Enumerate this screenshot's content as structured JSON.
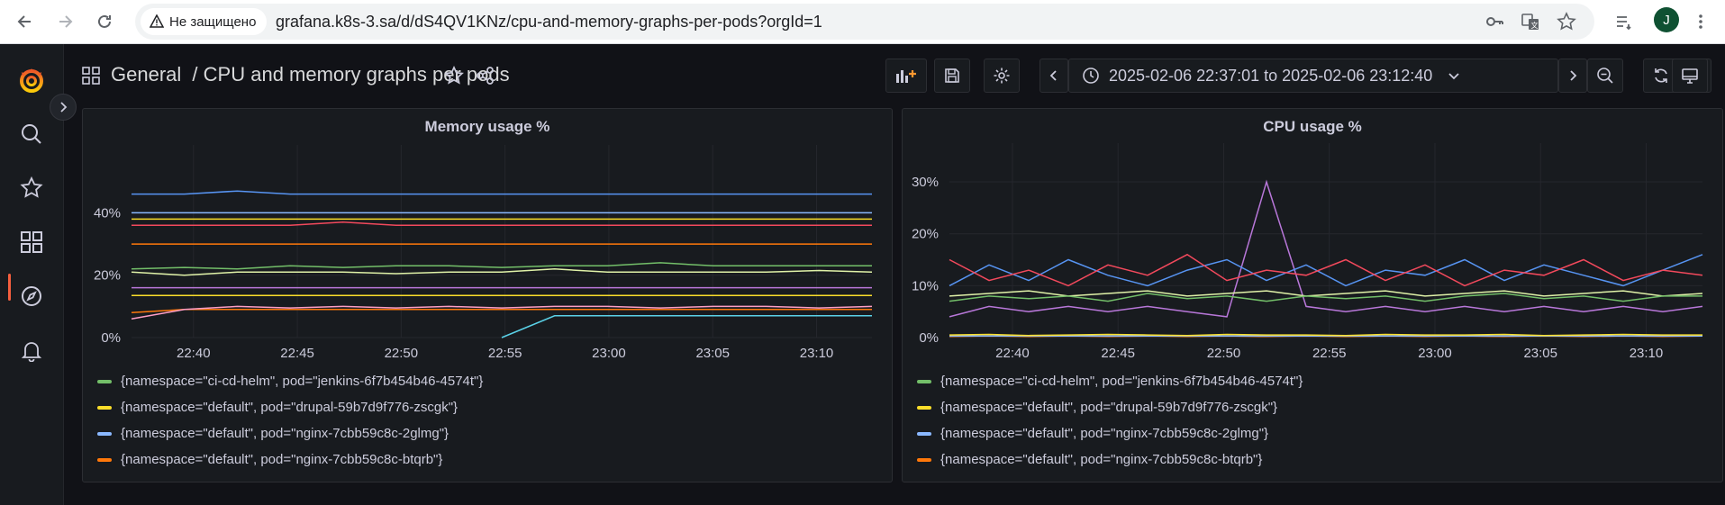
{
  "browser": {
    "security_label": "Не защищено",
    "url": "grafana.k8s-3.sa/d/dS4QV1KNz/cpu-and-memory-graphs-per-pods?orgId=1",
    "avatar_letter": "J"
  },
  "header": {
    "breadcrumb_root": "General",
    "separator": "/",
    "dashboard_title": "CPU and memory graphs per pods",
    "time_range": "2025-02-06 22:37:01 to 2025-02-06 23:12:40"
  },
  "colors": {
    "green": "#73bf69",
    "yellow": "#fade2a",
    "blue": "#8ab8ff",
    "orange": "#ff780a",
    "red": "#f2495c",
    "purple": "#b877d9",
    "darkblue": "#5794f2",
    "pink": "#ff9ec5",
    "cyan": "#5ad2e8",
    "lime": "#e0f2a8"
  },
  "legend": [
    {
      "label": "{namespace=\"ci-cd-helm\", pod=\"jenkins-6f7b454b46-4574t\"}",
      "color": "#73bf69"
    },
    {
      "label": "{namespace=\"default\", pod=\"drupal-59b7d9f776-zscgk\"}",
      "color": "#fade2a"
    },
    {
      "label": "{namespace=\"default\", pod=\"nginx-7cbb59c8c-2glmg\"}",
      "color": "#8ab8ff"
    },
    {
      "label": "{namespace=\"default\", pod=\"nginx-7cbb59c8c-btqrb\"}",
      "color": "#ff780a"
    }
  ],
  "chart_data": [
    {
      "type": "line",
      "title": "Memory usage %",
      "x_ticks": [
        "22:40",
        "22:45",
        "22:50",
        "22:55",
        "23:00",
        "23:05",
        "23:10"
      ],
      "y_ticks": [
        "0%",
        "20%",
        "40%"
      ],
      "ylim": [
        0,
        56
      ],
      "x_range": [
        "22:37:01",
        "23:12:40"
      ],
      "grid": true,
      "legend_placement": "bottom",
      "series": [
        {
          "name": "{namespace=\"ci-cd-helm\", pod=\"jenkins-6f7b454b46-4574t\"}",
          "color": "#73bf69",
          "values": [
            22,
            22.5,
            22,
            23,
            22.5,
            23,
            23,
            22.5,
            23,
            23,
            24,
            23,
            23,
            23,
            23
          ]
        },
        {
          "name": "{namespace=\"default\", pod=\"drupal-59b7d9f776-zscgk\"}",
          "color": "#fade2a",
          "values": [
            38,
            38,
            38,
            38,
            38,
            38,
            38,
            38,
            38,
            38,
            38,
            38,
            38,
            38,
            38
          ]
        },
        {
          "name": "{namespace=\"default\", pod=\"nginx-7cbb59c8c-2glmg\"}",
          "color": "#8ab8ff",
          "values": [
            40,
            40,
            40,
            40,
            40,
            40,
            40,
            40,
            40,
            40,
            40,
            40,
            40,
            40,
            40
          ]
        },
        {
          "name": "{namespace=\"default\", pod=\"nginx-7cbb59c8c-btqrb\"}",
          "color": "#ff780a",
          "values": [
            30,
            30,
            30,
            30,
            30,
            30,
            30,
            30,
            30,
            30,
            30,
            30,
            30,
            30,
            30
          ]
        },
        {
          "color": "#5794f2",
          "values": [
            46,
            46,
            47,
            46,
            46,
            46,
            46,
            46,
            46,
            46,
            46,
            46,
            46,
            46,
            46
          ]
        },
        {
          "color": "#f2495c",
          "values": [
            36,
            36,
            36,
            36,
            37,
            36,
            36,
            36,
            36,
            36,
            36,
            36,
            36,
            36,
            36
          ]
        },
        {
          "color": "#e0f2a8",
          "values": [
            21,
            20,
            21,
            21,
            21,
            20.5,
            21,
            21,
            22,
            21,
            21,
            21,
            21,
            21.5,
            21
          ]
        },
        {
          "color": "#b877d9",
          "values": [
            16,
            16,
            16,
            16,
            16,
            16,
            16,
            16,
            16,
            16,
            16,
            16,
            16,
            16,
            16
          ]
        },
        {
          "color": "#fade2a",
          "values": [
            13.5,
            13.5,
            13.5,
            13.5,
            13.5,
            13.5,
            13.5,
            13.5,
            13.5,
            13.5,
            13.5,
            13.5,
            13.5,
            13.5,
            13.5
          ]
        },
        {
          "color": "#ff9ec5",
          "values": [
            6,
            9,
            10,
            9.5,
            10,
            9.5,
            10,
            9.5,
            10,
            10,
            9.5,
            10,
            10,
            9.5,
            10
          ]
        },
        {
          "color": "#ff780a",
          "values": [
            8,
            9,
            9,
            9,
            9,
            9,
            9,
            9,
            9,
            9,
            9,
            9,
            9,
            9,
            9
          ]
        },
        {
          "color": "#5ad2e8",
          "values": [
            null,
            null,
            null,
            null,
            null,
            null,
            null,
            0,
            7,
            7,
            7,
            7,
            7,
            7,
            7
          ]
        }
      ]
    },
    {
      "type": "line",
      "title": "CPU usage %",
      "x_ticks": [
        "22:40",
        "22:45",
        "22:50",
        "22:55",
        "23:00",
        "23:05",
        "23:10"
      ],
      "y_ticks": [
        "0%",
        "10%",
        "20%",
        "30%"
      ],
      "ylim": [
        0,
        34
      ],
      "x_range": [
        "22:37:01",
        "23:12:40"
      ],
      "grid": true,
      "legend_placement": "bottom",
      "series": [
        {
          "name": "{namespace=\"ci-cd-helm\", pod=\"jenkins-6f7b454b46-4574t\"}",
          "color": "#73bf69",
          "values": [
            7,
            8,
            7.5,
            8,
            7,
            8.5,
            7.5,
            8,
            7,
            8,
            7.5,
            8,
            7,
            8,
            8.5,
            7.5,
            8,
            7,
            8,
            8
          ]
        },
        {
          "name": "{namespace=\"default\", pod=\"drupal-59b7d9f776-zscgk\"}",
          "color": "#fade2a",
          "values": [
            0.5,
            0.6,
            0.4,
            0.5,
            0.6,
            0.5,
            0.4,
            0.6,
            0.5,
            0.5,
            0.4,
            0.6,
            0.5,
            0.5,
            0.6,
            0.4,
            0.5,
            0.6,
            0.5,
            0.5
          ]
        },
        {
          "name": "{namespace=\"default\", pod=\"nginx-7cbb59c8c-2glmg\"}",
          "color": "#8ab8ff",
          "values": [
            0.3,
            0.3,
            0.3,
            0.3,
            0.3,
            0.3,
            0.3,
            0.3,
            0.3,
            0.3,
            0.3,
            0.3,
            0.3,
            0.3,
            0.3,
            0.3,
            0.3,
            0.3,
            0.3,
            0.3
          ]
        },
        {
          "name": "{namespace=\"default\", pod=\"nginx-7cbb59c8c-btqrb\"}",
          "color": "#ff780a",
          "values": [
            0.2,
            0.3,
            0.2,
            0.3,
            0.2,
            0.3,
            0.2,
            0.3,
            0.2,
            0.3,
            0.2,
            0.3,
            0.2,
            0.3,
            0.2,
            0.3,
            0.2,
            0.3,
            0.2,
            0.3
          ]
        },
        {
          "color": "#f2495c",
          "values": [
            15,
            11,
            13,
            10,
            14,
            12,
            16,
            11,
            13,
            12,
            15,
            11,
            14,
            10,
            13,
            12,
            15,
            11,
            13,
            12
          ]
        },
        {
          "color": "#5794f2",
          "values": [
            10,
            14,
            11,
            15,
            12,
            10,
            13,
            15,
            11,
            14,
            10,
            13,
            12,
            15,
            11,
            14,
            12,
            10,
            13,
            16
          ]
        },
        {
          "color": "#e0f2a8",
          "values": [
            8,
            8.5,
            9,
            8,
            8.5,
            9,
            8,
            8.5,
            9,
            8,
            8.5,
            9,
            8,
            8.5,
            9,
            8,
            8.5,
            9,
            8,
            8.5
          ]
        },
        {
          "color": "#b877d9",
          "values": [
            4,
            6,
            5,
            6,
            5,
            6,
            5,
            4,
            30,
            6,
            5,
            6,
            5,
            6,
            5,
            6,
            5,
            6,
            5,
            6
          ]
        }
      ]
    }
  ]
}
